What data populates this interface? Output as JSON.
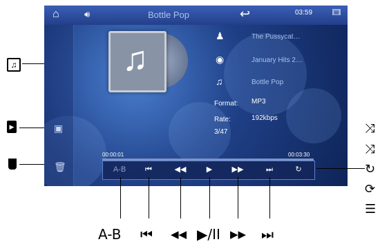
{
  "screen": {
    "title": "Bottle Pop",
    "time": "03:59",
    "artist": "The Pussycat…",
    "album": "January Hits 2…",
    "song": "Bottle Pop",
    "format_label": "Format:",
    "format_value": "MP3",
    "rate_label": "Rate:",
    "rate_value": "192kbps",
    "track_counter": "3/47",
    "elapsed": "00:00:01",
    "total": "00:03:30",
    "ab_label": "A-B"
  },
  "controls": {
    "prev": "⏮",
    "rewind": "◀◀",
    "play": "▶",
    "forward": "▶▶",
    "next": "⏭",
    "repeat": "↻"
  },
  "callouts": {
    "ab": "A-B",
    "prev": "⏮",
    "rewind": "◀◀",
    "playpause": "▶/II",
    "forward": "▶▶",
    "next": "⏭"
  },
  "right_icons": [
    "shuffle",
    "shuffle",
    "repeat-one",
    "repeat-all",
    "playlist"
  ],
  "colors": {
    "screen_bg": "#1f3f86",
    "topbar": "#3b5fb6"
  }
}
